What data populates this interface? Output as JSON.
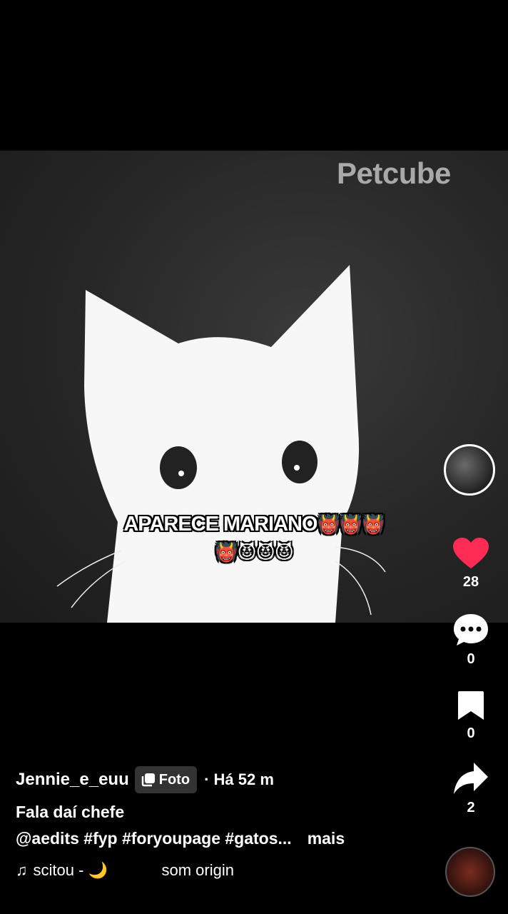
{
  "media": {
    "watermark": "Petcube",
    "overlay_line1": "APARECE MARIANO",
    "overlay_line1_emoji": "👹👹👹",
    "overlay_line2_emoji": "👹😈😈😈"
  },
  "actions": {
    "likes": "28",
    "comments": "0",
    "saves": "0",
    "shares": "2",
    "like_color": "#fe2c55"
  },
  "post": {
    "username": "Jennie_e_euu",
    "badge": "Foto",
    "time": "· Há 52 m",
    "caption": "Fala daí chefe",
    "tags": "@aedits #fyp #foryoupage #gatos...",
    "more": "mais",
    "music_note": "♫",
    "music_text": "scitou - 🌙",
    "music_sound": "som origin"
  },
  "icons": [
    "heart-icon",
    "comment-icon",
    "bookmark-icon",
    "share-icon",
    "photo-icon",
    "music-note-icon"
  ]
}
